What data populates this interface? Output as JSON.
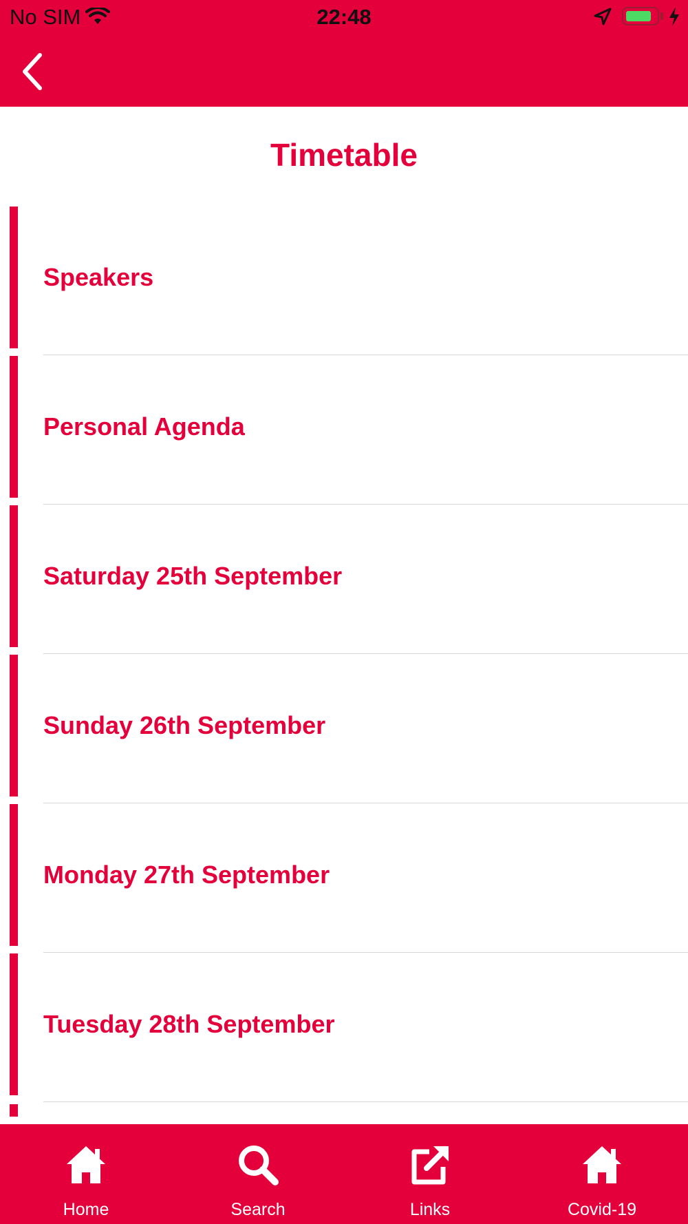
{
  "colors": {
    "accent": "#E4003B",
    "text_light": "#FFFFFF",
    "separator": "#D6D6D6",
    "battery_green": "#4CD964"
  },
  "status_bar": {
    "carrier": "No SIM",
    "time": "22:48",
    "battery_level": 0.85,
    "icons": [
      "wifi-icon",
      "location-arrow-icon",
      "battery-icon",
      "charging-bolt-icon"
    ]
  },
  "nav": {
    "back_icon": "chevron-left-icon"
  },
  "page": {
    "title": "Timetable"
  },
  "list": {
    "items": [
      {
        "label": "Speakers"
      },
      {
        "label": "Personal Agenda"
      },
      {
        "label": "Saturday 25th September"
      },
      {
        "label": "Sunday 26th September"
      },
      {
        "label": "Monday 27th September"
      },
      {
        "label": "Tuesday 28th September"
      }
    ]
  },
  "tab_bar": {
    "tabs": [
      {
        "label": "Home",
        "icon": "home-icon"
      },
      {
        "label": "Search",
        "icon": "search-icon"
      },
      {
        "label": "Links",
        "icon": "external-link-icon"
      },
      {
        "label": "Covid-19",
        "icon": "home-icon"
      }
    ]
  }
}
